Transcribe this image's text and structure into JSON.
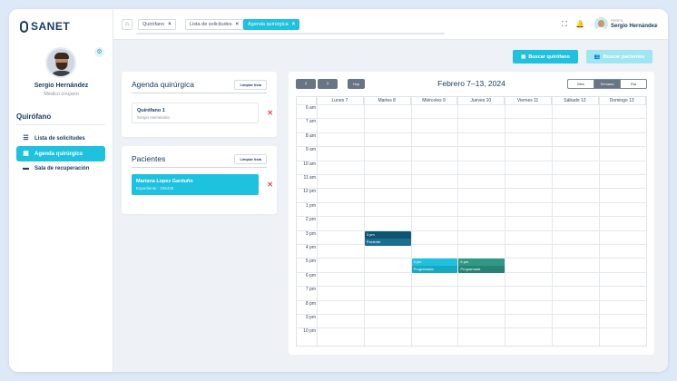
{
  "app": {
    "brand": "SANET"
  },
  "user": {
    "name": "Sergio Hernández",
    "role": "Médico cirujano",
    "gear_icon": "gear-icon"
  },
  "sidebar": {
    "section_title": "Quirófano",
    "items": [
      {
        "label": "Lista de solicitudes",
        "icon": "list-icon",
        "active": false
      },
      {
        "label": "Agenda quirúrgica",
        "icon": "calendar-icon",
        "active": true
      },
      {
        "label": "Sala de recuperación",
        "icon": "bed-icon",
        "active": false
      }
    ]
  },
  "topbar": {
    "tabs": [
      {
        "label": "Quirófano",
        "active": false
      },
      {
        "label": "Lista de solicitudes",
        "active": false
      },
      {
        "label": "Agenda quirúrgica",
        "active": true
      }
    ],
    "profile_label": "PERFIL",
    "profile_name": "Sergio Hernández"
  },
  "actions": {
    "search_or": "Buscar quirófano",
    "search_patients": "Buscar pacientes"
  },
  "agenda_card": {
    "title": "Agenda quirúrgica",
    "clear": "Limpiar lista",
    "item_title": "Quirófano 1",
    "item_sub": "Sergio Hernández"
  },
  "patients_card": {
    "title": "Pacientes",
    "clear": "Limpiar lista",
    "item_title": "Mariana Lopez Garduño",
    "item_sub": "Expediente : 235436"
  },
  "calendar": {
    "prev": "‹",
    "next": "›",
    "today": "Hoy",
    "title": "Febrero 7–13, 2024",
    "views": [
      "Mes",
      "Semana",
      "Día"
    ],
    "active_view": "Semana",
    "days": [
      "Lunes 7",
      "Martes 8",
      "Miércoles 9",
      "Jueves 10",
      "Viernes 11",
      "Sábado 12",
      "Domingo 13"
    ],
    "hours": [
      "6 am",
      "7 am",
      "8 am",
      "9 am",
      "10 am",
      "11 am",
      "12 pm",
      "1 pm",
      "2 pm",
      "3 pm",
      "4 pm",
      "5 pm",
      "6 pm",
      "7 pm",
      "8 pm",
      "9 pm",
      "10 pm"
    ],
    "events": [
      {
        "day": 1,
        "hour": "3 pm",
        "time": "3 pm",
        "label": "Paciente",
        "color_top": "#0e5574",
        "color_bottom": "#1a6f8e"
      },
      {
        "day": 2,
        "hour": "5 pm",
        "time": "5 pm",
        "label": "Programada",
        "color_top": "#1ec1de",
        "color_bottom": "#17a8c2"
      },
      {
        "day": 3,
        "hour": "5 pm",
        "time": "5 pm",
        "label": "Programada",
        "color_top": "#2e9a86",
        "color_bottom": "#268272"
      }
    ]
  },
  "colors": {
    "accent": "#1ec1de",
    "navy": "#1d3b63",
    "danger": "#e24b4b"
  }
}
